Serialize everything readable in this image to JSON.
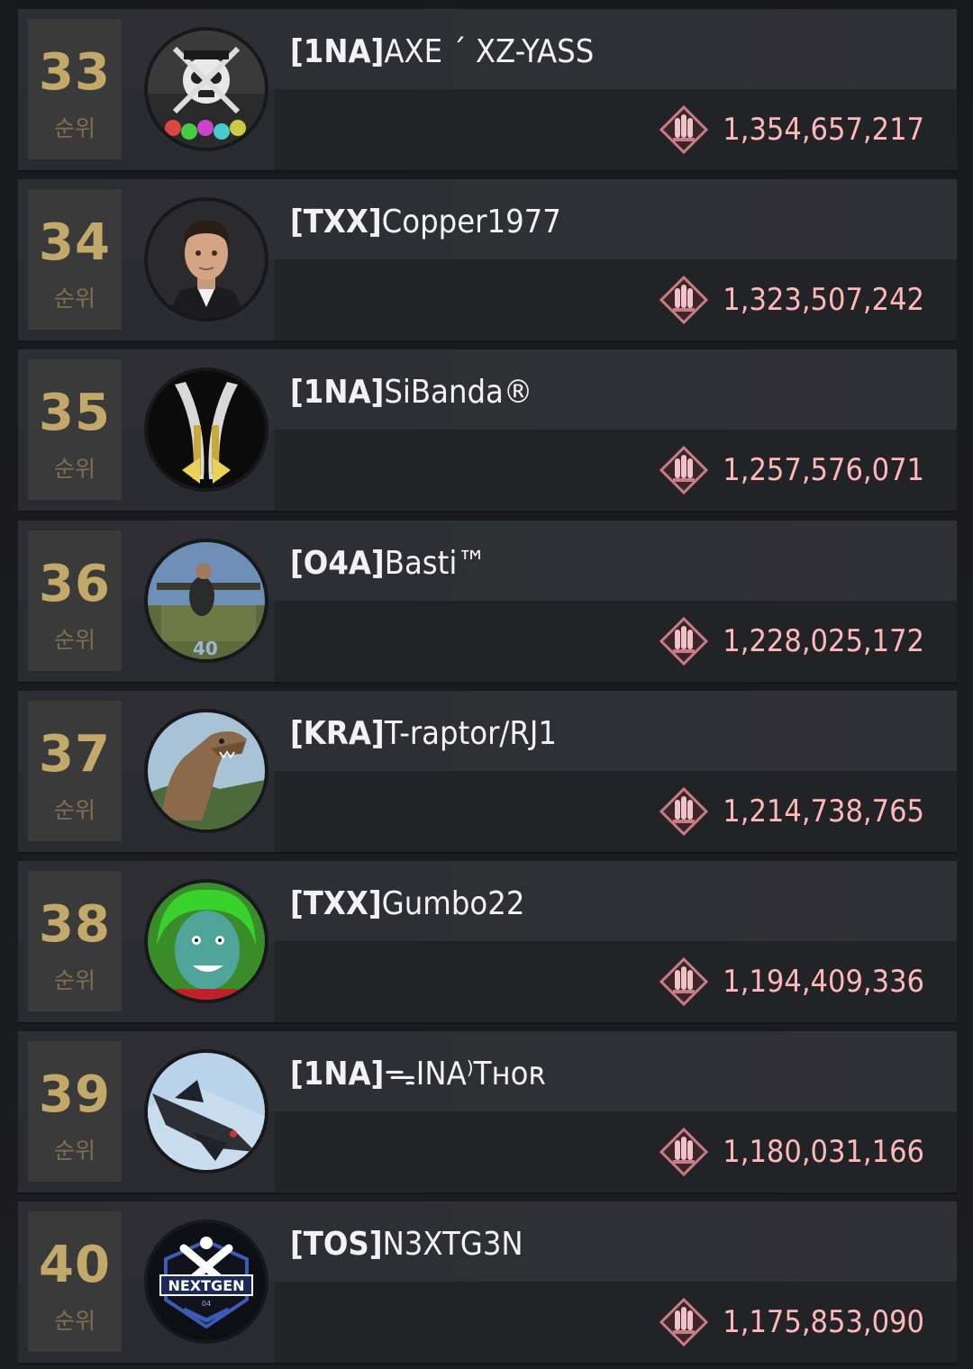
{
  "rank_suffix": "순위",
  "colors": {
    "rank_number": "#c2a869",
    "rank_suffix": "#7d6f4e",
    "score": "#ffb8b8",
    "score_icon": "#c97c84",
    "player_name": "#f2f2f2"
  },
  "score_icon": "bullets-emblem-icon",
  "rows": [
    {
      "rank": "33",
      "tag": "[1NA]",
      "name": "AXE ´ XZ-YASS",
      "score": "1,354,657,217",
      "avatar": "skull-crossbones-avatar"
    },
    {
      "rank": "34",
      "tag": "[TXX]",
      "name": "Copper1977",
      "score": "1,323,507,242",
      "avatar": "man-in-suit-avatar"
    },
    {
      "rank": "35",
      "tag": "[1NA]",
      "name": "SiBanda®",
      "score": "1,257,576,071",
      "avatar": "crest-emblem-avatar"
    },
    {
      "rank": "36",
      "tag": "[O4A]",
      "name": "Basti™",
      "score": "1,228,025,172",
      "avatar": "soldier-on-tank-avatar"
    },
    {
      "rank": "37",
      "tag": "[KRA]",
      "name": "T-raptor/RJ1",
      "score": "1,214,738,765",
      "avatar": "t-rex-avatar"
    },
    {
      "rank": "38",
      "tag": "[TXX]",
      "name": "Gumbo22",
      "score": "1,194,409,336",
      "avatar": "green-hair-face-avatar"
    },
    {
      "rank": "39",
      "tag": "[1NA]",
      "name": "ᯓINA⁾Tʜᴏʀ",
      "score": "1,180,031,166",
      "avatar": "fighter-jet-avatar"
    },
    {
      "rank": "40",
      "tag": "[TOS]",
      "name": "N3XTG3N",
      "score": "1,175,853,090",
      "avatar": "nextgen-logo-avatar"
    }
  ],
  "nextgen_logo": {
    "word": "NEXTGEN",
    "sub": "04"
  }
}
